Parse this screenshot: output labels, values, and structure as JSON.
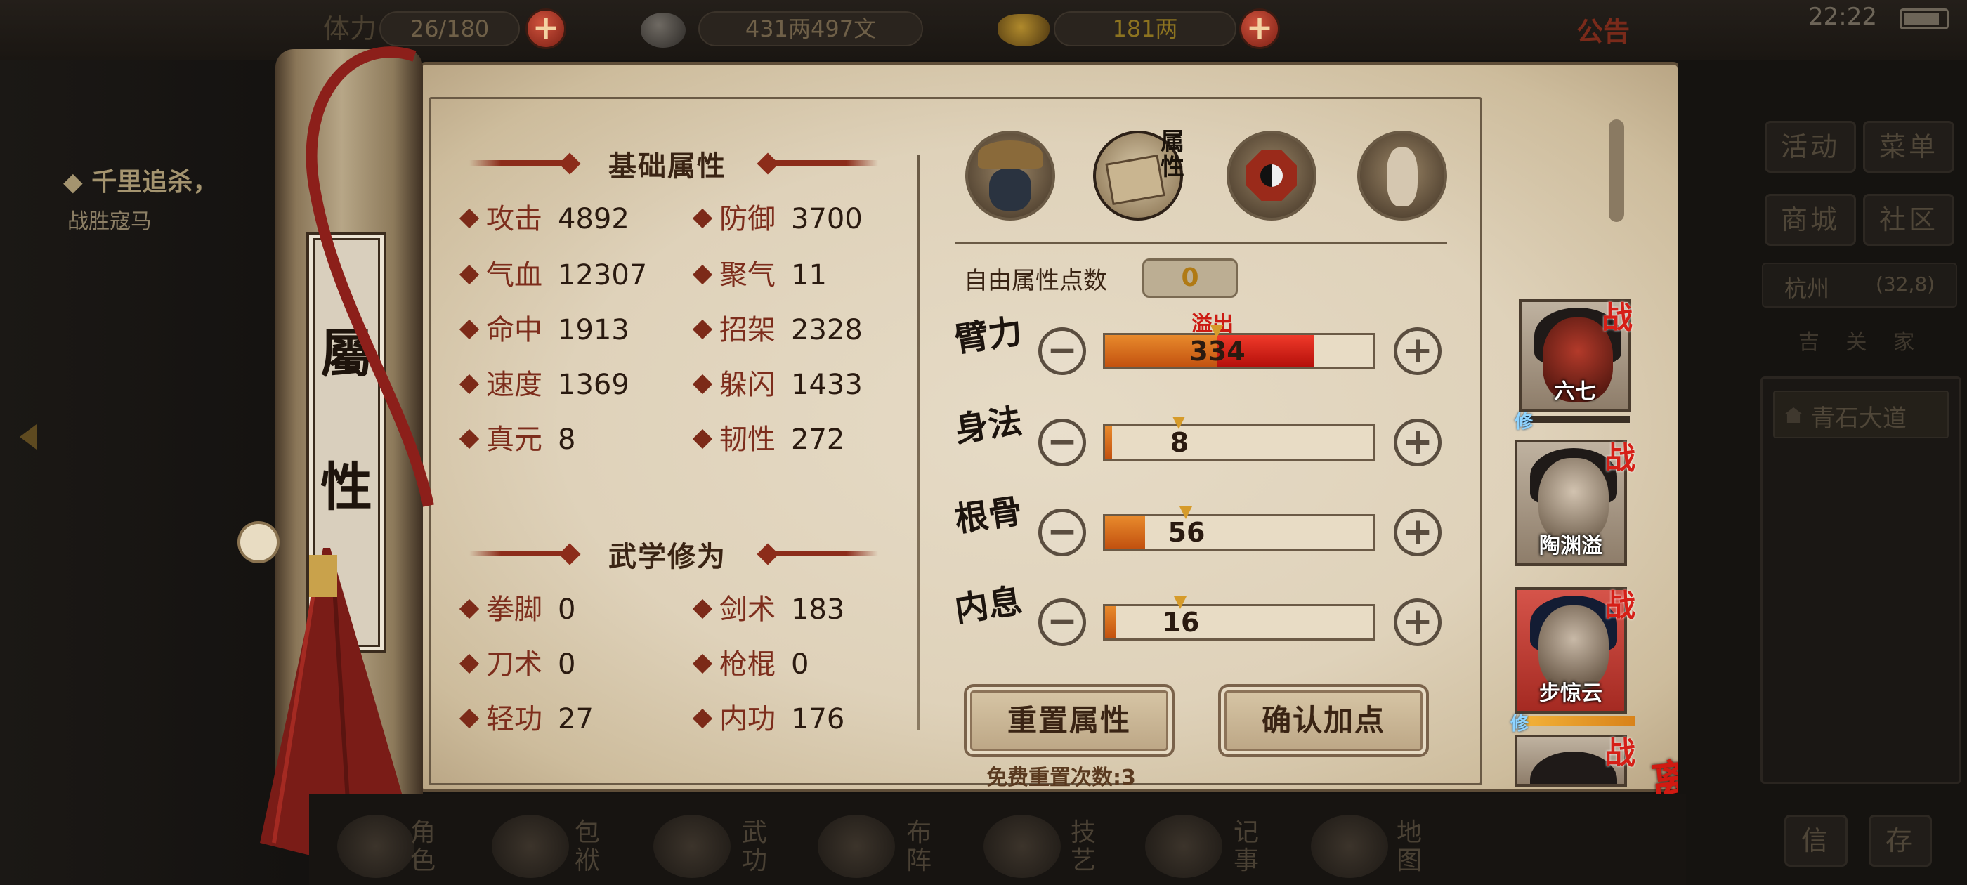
{
  "top": {
    "stamina_label": "体力",
    "stamina_value": "26/180",
    "money_value": "431两497文",
    "gold_value": "181两",
    "notice_label": "公告",
    "time": "22:22"
  },
  "quest": {
    "title": "千里追杀，",
    "subtitle": "战胜寇马"
  },
  "scroll_tab": {
    "char1": "屬",
    "char2": "性"
  },
  "base_attrs": {
    "title": "基础属性",
    "items": [
      {
        "label": "攻击",
        "value": "4892"
      },
      {
        "label": "防御",
        "value": "3700"
      },
      {
        "label": "气血",
        "value": "12307"
      },
      {
        "label": "聚气",
        "value": "11"
      },
      {
        "label": "命中",
        "value": "1913"
      },
      {
        "label": "招架",
        "value": "2328"
      },
      {
        "label": "速度",
        "value": "1369"
      },
      {
        "label": "躲闪",
        "value": "1433"
      },
      {
        "label": "真元",
        "value": "8"
      },
      {
        "label": "韧性",
        "value": "272"
      }
    ]
  },
  "martial": {
    "title": "武学修为",
    "items": [
      {
        "label": "拳脚",
        "value": "0"
      },
      {
        "label": "剑术",
        "value": "183"
      },
      {
        "label": "刀术",
        "value": "0"
      },
      {
        "label": "枪棍",
        "value": "0"
      },
      {
        "label": "轻功",
        "value": "27"
      },
      {
        "label": "内功",
        "value": "176"
      }
    ]
  },
  "tabs": {
    "attr_tab_label": "属性"
  },
  "free_points": {
    "label": "自由属性点数",
    "value": "0"
  },
  "overflow_label": "溢出",
  "attributes": [
    {
      "label": "臂力",
      "value": "334",
      "orange_fill": 0.42,
      "red_fill": 0.36
    },
    {
      "label": "身法",
      "value": "8",
      "orange_fill": 0.025,
      "red_fill": 0
    },
    {
      "label": "根骨",
      "value": "56",
      "orange_fill": 0.15,
      "red_fill": 0
    },
    {
      "label": "内息",
      "value": "16",
      "orange_fill": 0.04,
      "red_fill": 0
    }
  ],
  "buttons": {
    "reset": "重置属性",
    "confirm": "确认加点",
    "free_reset": "免费重置次数:3"
  },
  "heroes": [
    {
      "name": "六七",
      "tag": "战",
      "xiu": "修"
    },
    {
      "name": "陶渊溢",
      "tag": "战"
    },
    {
      "name": "步惊云",
      "tag": "战",
      "xiu": "修"
    },
    {
      "name": "",
      "tag": "战"
    }
  ],
  "leave_label": "离开",
  "right_menu": {
    "activity": "活动",
    "menu": "菜单",
    "shop": "商城",
    "community": "社区",
    "location": "杭州",
    "coords": "(32,8)",
    "place": "青石大道",
    "hint_chars": "吉 关 家",
    "btn_a": "信",
    "btn_b": "存"
  },
  "bottom_nav": [
    "角色",
    "包袱",
    "武功",
    "布阵",
    "技艺",
    "记事",
    "地图"
  ],
  "colors": {
    "accent_red": "#8c2c1a",
    "bar_orange": "#e07a22",
    "bar_red": "#e02a1e",
    "warning_red": "#d61f17"
  }
}
